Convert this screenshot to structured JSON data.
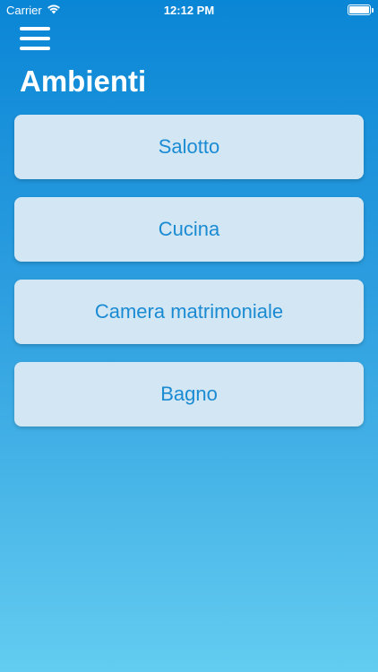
{
  "status_bar": {
    "carrier": "Carrier",
    "time": "12:12 PM",
    "icons": [
      "wifi-icon",
      "battery-icon"
    ]
  },
  "header": {
    "menu_icon": "hamburger-menu-icon",
    "title": "Ambienti"
  },
  "rooms": [
    {
      "label": "Salotto"
    },
    {
      "label": "Cucina"
    },
    {
      "label": "Camera matrimoniale"
    },
    {
      "label": "Bagno"
    }
  ],
  "colors": {
    "gradient_top": "#0A86D6",
    "gradient_bottom": "#63CCF0",
    "button_bg": "#D3E6F3",
    "button_text": "#1A8BD3"
  }
}
